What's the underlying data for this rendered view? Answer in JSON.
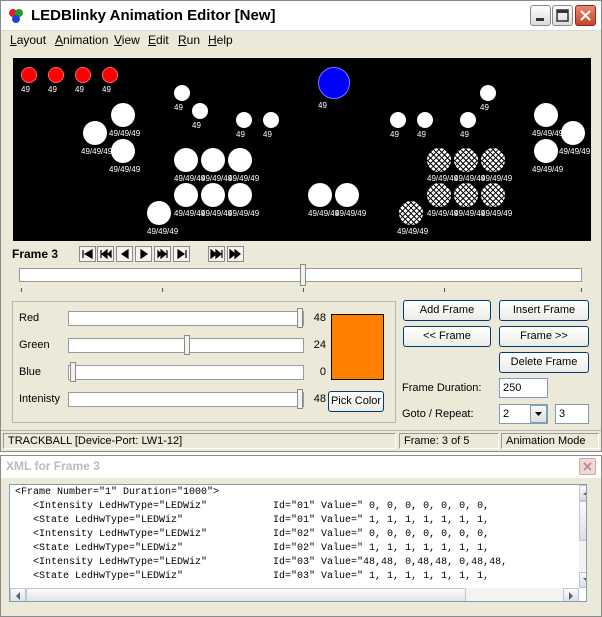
{
  "window": {
    "title": "LEDBlinky Animation Editor [New]"
  },
  "menu": [
    {
      "label": "Layout",
      "ul": "L",
      "rest": "ayout"
    },
    {
      "label": "Animation",
      "ul": "A",
      "rest": "nimation"
    },
    {
      "label": "View",
      "ul": "V",
      "rest": "iew"
    },
    {
      "label": "Edit",
      "ul": "E",
      "rest": "dit"
    },
    {
      "label": "Run",
      "ul": "R",
      "rest": "un"
    },
    {
      "label": "Help",
      "ul": "H",
      "rest": "elp"
    }
  ],
  "colors": {
    "canvas_bg": "#000000",
    "led_red": "#ff0000",
    "led_blue": "#0000ff",
    "led_white": "#ffffff",
    "swatch": "#ff8000"
  },
  "leds": {
    "single_label": "49",
    "triple_label": "49/49/49"
  },
  "frame": {
    "label": "Frame 3"
  },
  "nav_icons": [
    "first-frame-icon",
    "prev-step-icon",
    "prev-icon",
    "next-icon",
    "next-step-icon",
    "last-frame-icon",
    "fast-forward-icon",
    "skip-forward-icon"
  ],
  "sliders": {
    "red": {
      "label": "Red",
      "value": "48"
    },
    "green": {
      "label": "Green",
      "value": "24"
    },
    "blue": {
      "label": "Blue",
      "value": "0"
    },
    "intensity": {
      "label": "Intenisty",
      "value": "48"
    }
  },
  "buttons": {
    "pick_color": "Pick Color",
    "add_frame": "Add Frame",
    "insert_frame": "Insert Frame",
    "prev_frame": "<< Frame",
    "next_frame": "Frame >>",
    "delete_frame": "Delete Frame"
  },
  "fields": {
    "duration_label": "Frame Duration:",
    "duration_value": "250",
    "goto_label": "Goto / Repeat:",
    "goto_value": "2",
    "repeat_value": "3"
  },
  "status": {
    "device": "TRACKBALL [Device-Port: LW1-12]",
    "frame": "Frame: 3 of 5",
    "mode": "Animation Mode"
  },
  "xml": {
    "title": "XML for Frame 3",
    "lines": [
      "<Frame Number=\"1\" Duration=\"1000\">",
      "   <Intensity LedHwType=\"LEDWiz\"           Id=\"01\" Value=\" 0, 0, 0, 0, 0, 0, 0,",
      "   <State LedHwType=\"LEDWiz\"               Id=\"01\" Value=\" 1, 1, 1, 1, 1, 1, 1,",
      "   <Intensity LedHwType=\"LEDWiz\"           Id=\"02\" Value=\" 0, 0, 0, 0, 0, 0, 0,",
      "   <State LedHwType=\"LEDWiz\"               Id=\"02\" Value=\" 1, 1, 1, 1, 1, 1, 1,",
      "   <Intensity LedHwType=\"LEDWiz\"           Id=\"03\" Value=\"48,48, 0,48,48, 0,48,48,",
      "   <State LedHwType=\"LEDWiz\"               Id=\"03\" Value=\" 1, 1, 1, 1, 1, 1, 1,"
    ]
  }
}
